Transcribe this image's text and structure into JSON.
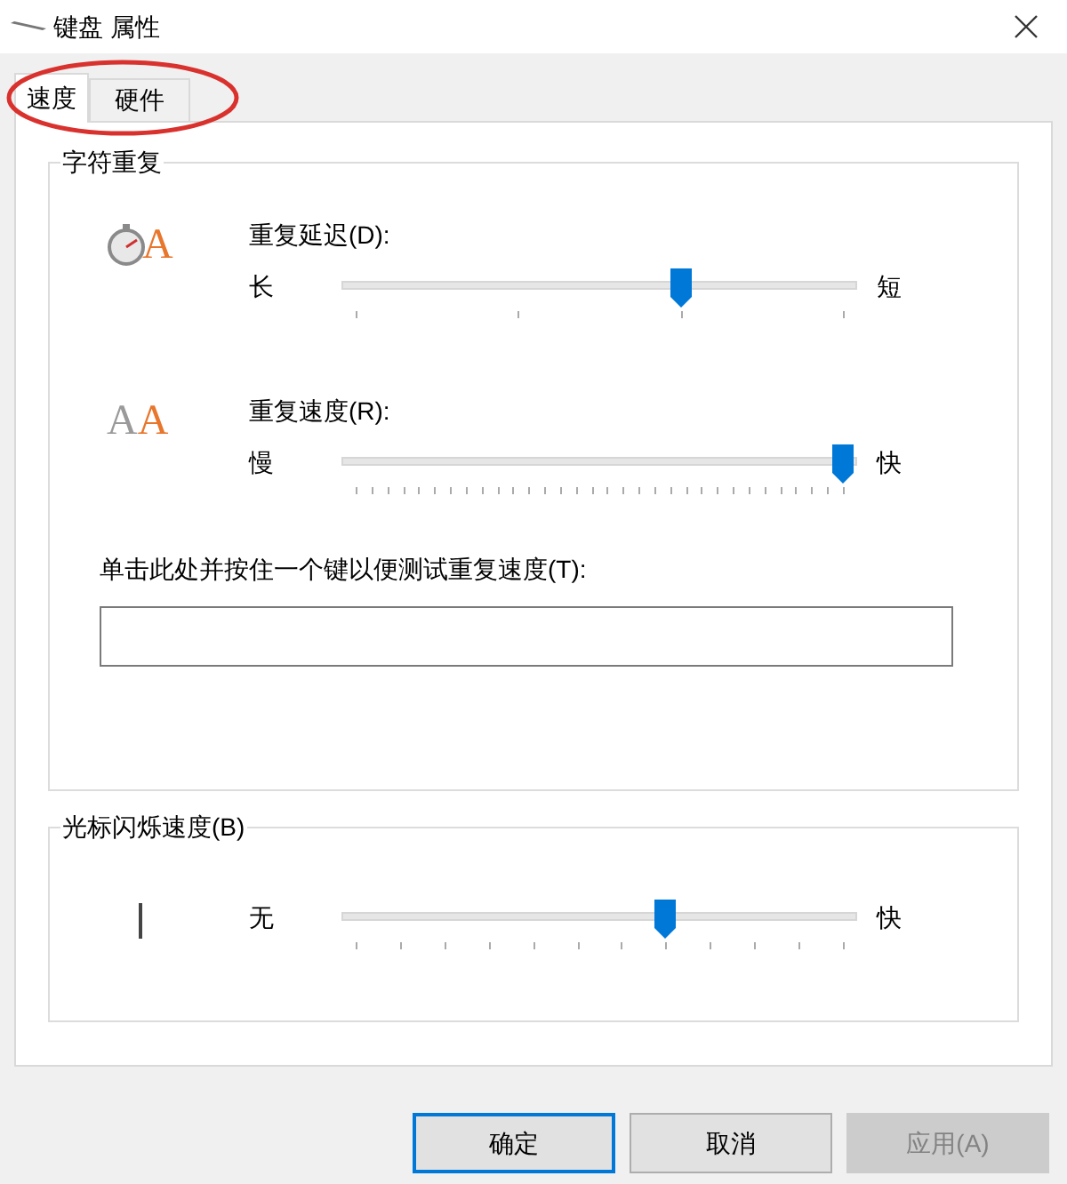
{
  "window": {
    "title": "键盘 属性"
  },
  "tabs": [
    {
      "label": "速度",
      "selected": true
    },
    {
      "label": "硬件",
      "selected": false
    }
  ],
  "annotation": {
    "kind": "ellipse",
    "color": "#d9322e"
  },
  "groups": [
    {
      "title": "字符重复",
      "sliders": [
        {
          "glyphs": [
            "A"
          ],
          "label": "重复延迟(D):",
          "low": "长",
          "high": "短",
          "level": 0.667
        },
        {
          "glyphs": [
            "A",
            "A"
          ],
          "label": "重复速度(R):",
          "low": "慢",
          "high": "快",
          "level": 1
        }
      ],
      "test": {
        "label": "单击此处并按住一个键以便测试重复速度(T):"
      }
    },
    {
      "title": "光标闪烁速度(B)",
      "sliders": [
        {
          "low": "无",
          "high": "快",
          "level": 0.636
        }
      ]
    }
  ],
  "buttons": [
    {
      "label": "确定",
      "default": true,
      "disabled": false
    },
    {
      "label": "取消",
      "default": false,
      "disabled": false
    },
    {
      "label": "应用(A)",
      "default": false,
      "disabled": true
    }
  ]
}
